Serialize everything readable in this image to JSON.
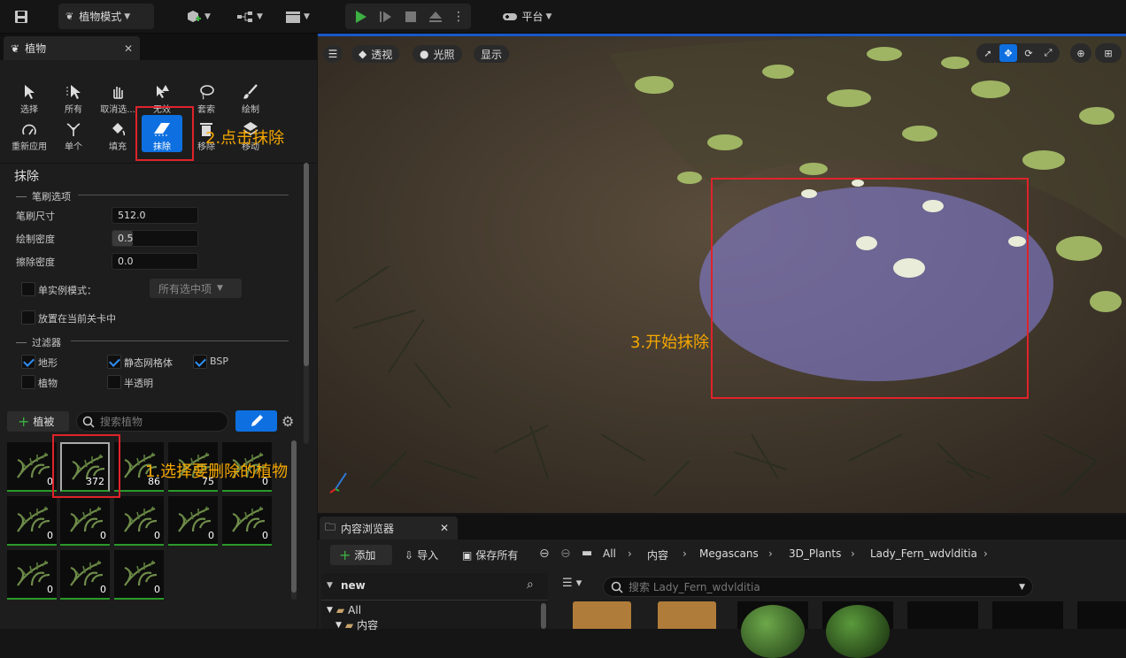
{
  "topbar": {
    "mode_label": "植物模式",
    "platform_label": "平台"
  },
  "foliage_panel": {
    "tab_title": "植物",
    "tools": [
      {
        "label": "选择",
        "icon": "select-arrow-icon"
      },
      {
        "label": "所有",
        "icon": "select-all-icon"
      },
      {
        "label": "取消选...",
        "icon": "deselect-hand-icon"
      },
      {
        "label": "无效",
        "icon": "invalid-icon"
      },
      {
        "label": "套索",
        "icon": "lasso-icon"
      },
      {
        "label": "绘制",
        "icon": "paint-brush-icon"
      },
      {
        "label": "重新应用",
        "icon": "reapply-icon"
      },
      {
        "label": "单个",
        "icon": "single-icon"
      },
      {
        "label": "填充",
        "icon": "fill-icon"
      },
      {
        "label": "抹除",
        "icon": "erase-icon"
      },
      {
        "label": "移除",
        "icon": "remove-icon"
      },
      {
        "label": "移动",
        "icon": "move-icon"
      }
    ],
    "section_title": "抹除",
    "brush_options_label": "笔刷选项",
    "brush_size_label": "笔刷尺寸",
    "brush_size_value": "512.0",
    "paint_density_label": "绘制密度",
    "paint_density_value": "0.5",
    "paint_density_fraction": 0.5,
    "erase_density_label": "擦除密度",
    "erase_density_value": "0.0",
    "single_instance_label": "单实例模式：",
    "single_instance_dropdown": "所有选中项",
    "place_in_level_label": "放置在当前关卡中",
    "filters_label": "过滤器",
    "filters": [
      {
        "label": "地形",
        "checked": true
      },
      {
        "label": "静态网格体",
        "checked": true
      },
      {
        "label": "BSP",
        "checked": true
      },
      {
        "label": "植物",
        "checked": false
      },
      {
        "label": "半透明",
        "checked": false
      }
    ],
    "add_foliage_label": "植被",
    "search_placeholder": "搜索植物",
    "foliage_counts": [
      "0",
      "372",
      "86",
      "75",
      "0",
      "0",
      "0",
      "0",
      "0",
      "0",
      "0",
      "0",
      "0"
    ]
  },
  "annotations": {
    "step1": "1.选择要删除的植物",
    "step2": "2.点击抹除",
    "step3": "3.开始抹除"
  },
  "viewport": {
    "perspective_label": "透视",
    "lit_label": "光照",
    "show_label": "显示"
  },
  "content_browser": {
    "tab_title": "内容浏览器",
    "add_label": "添加",
    "import_label": "导入",
    "save_all_label": "保存所有",
    "breadcrumbs": [
      "All",
      "内容",
      "Megascans",
      "3D_Plants",
      "Lady_Fern_wdvlditia"
    ],
    "search_placeholder": "搜索 Lady_Fern_wdvlditia",
    "tree_header": "new",
    "tree_items": [
      "All",
      "内容"
    ]
  }
}
